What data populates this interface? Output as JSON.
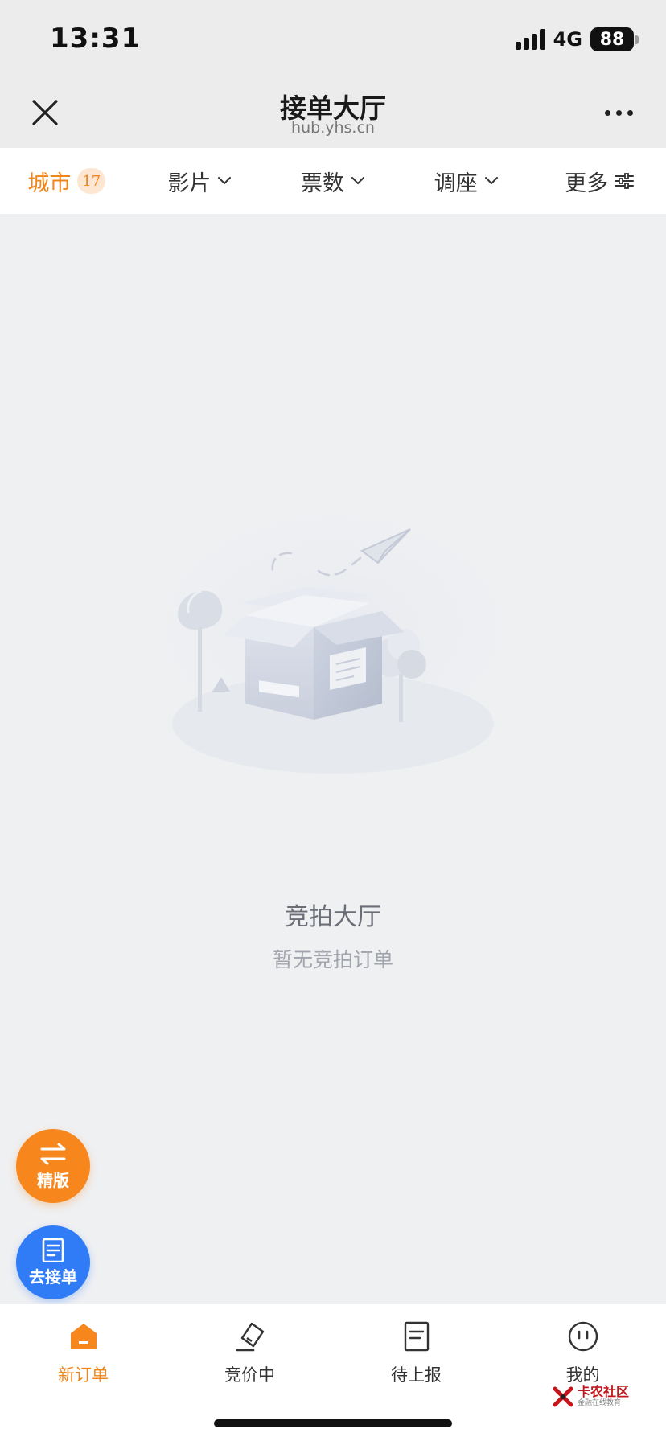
{
  "status_bar": {
    "time": "13:31",
    "network": "4G",
    "battery": "88"
  },
  "nav": {
    "title": "接单大厅",
    "subtitle": "hub.yhs.cn"
  },
  "filters": {
    "city": {
      "label": "城市",
      "count": "17"
    },
    "items": [
      {
        "label": "影片"
      },
      {
        "label": "票数"
      },
      {
        "label": "调座"
      }
    ],
    "more": {
      "label": "更多"
    }
  },
  "empty_state": {
    "title": "竞拍大厅",
    "subtitle": "暂无竞拍订单"
  },
  "fabs": {
    "pro": {
      "label": "精版"
    },
    "take": {
      "label": "去接单"
    }
  },
  "tabs": [
    {
      "label": "新订单",
      "active": true
    },
    {
      "label": "竞价中",
      "active": false
    },
    {
      "label": "待上报",
      "active": false
    },
    {
      "label": "我的",
      "active": false
    }
  ],
  "watermark": {
    "title": "卡农社区",
    "subtitle": "金融在线教育"
  },
  "colors": {
    "accent": "#f0861a",
    "fab_orange": "#f7861c",
    "fab_blue": "#2f7cf6",
    "background": "#eff0f2"
  }
}
